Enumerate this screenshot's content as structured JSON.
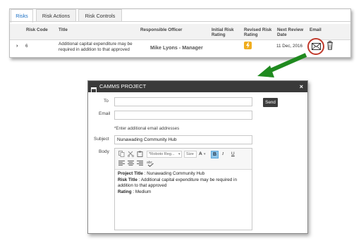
{
  "tabs": [
    {
      "label": "Risks",
      "active": true
    },
    {
      "label": "Risk Actions",
      "active": false
    },
    {
      "label": "Risk Controls",
      "active": false
    }
  ],
  "table": {
    "headers": {
      "code": "Risk Code",
      "title": "Title",
      "officer": "Responsible Officer",
      "initial": "Initial Risk Rating",
      "revised": "Revised Risk Rating",
      "review": "Next Review Date",
      "email": "Email"
    },
    "row": {
      "expand": "›",
      "code": "6",
      "title": "Additional capital expenditure may be required in addition to that approved",
      "officer": "Mike Lyons - Manager",
      "revised_rating_icon": "lightning-icon",
      "revised_rating_color": "#f0ad1e",
      "review_date": "11 Dec, 2016"
    }
  },
  "dialog": {
    "title": "CAMMS PROJECT",
    "close_label": "×",
    "to_label": "To",
    "to_value": "",
    "email_label": "Email",
    "email_value": "",
    "hint": "*Enter additional email addresses",
    "subject_label": "Subject",
    "subject_value": "Nunawading Community Hub",
    "body_label": "Body",
    "send_label": "Send",
    "toolbar": {
      "font_family": "*Roboto Reg...",
      "font_size": "Size",
      "bold": "B",
      "italic": "I",
      "underline": "U",
      "font_color": "A"
    },
    "body": {
      "project_title_label": "Project Title",
      "project_title_value": " : Nunawading Community Hub",
      "risk_title_label": "Risk Title",
      "risk_title_value": " : Additional capital expenditure may be required in addition to that approved",
      "rating_label": "Rating",
      "rating_value": " : Medium"
    }
  },
  "colors": {
    "accent_tab": "#1a6fc4",
    "dialog_header": "#3a3a3a",
    "highlight_circle": "#c0392b",
    "arrow": "#1f8a1f",
    "bold_active": "#8fc6ea"
  }
}
